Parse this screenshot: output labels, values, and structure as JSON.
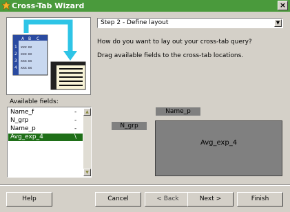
{
  "window": {
    "title": "Cross-Tab Wizard",
    "close_glyph": "×",
    "title_color": "#4a9a3c"
  },
  "step_combo": {
    "value": "Step 2 - Define layout",
    "arrow_glyph": "▼"
  },
  "instructions": {
    "question": "How do you want to lay out your cross-tab query?",
    "hint": "Drag available fields to the cross-tab locations."
  },
  "available_fields": {
    "label": "Available fields:",
    "items": [
      {
        "name": "Name_f",
        "marker": "-"
      },
      {
        "name": "N_grp",
        "marker": "-"
      },
      {
        "name": "Name_p",
        "marker": "-"
      },
      {
        "name": "Avg_exp_4",
        "marker": "\\",
        "selected": true
      }
    ],
    "scroll_up_glyph": "▲",
    "scroll_down_glyph": "▼"
  },
  "layout": {
    "column_field": "Name_p",
    "row_field": "N_grp",
    "data_field": "Avg_exp_4"
  },
  "buttons": {
    "help": "Help",
    "cancel": "Cancel",
    "back": "< Back",
    "next": "Next >",
    "finish": "Finish"
  },
  "illustration": {
    "row_numbers": [
      "1",
      "2",
      "3",
      "4"
    ],
    "header_letters": [
      "A",
      "B",
      "C"
    ],
    "cell_text": "xxx xx"
  },
  "colors": {
    "selection": "#1f6f18",
    "arrow": "#2ec4e6",
    "field_box": "#808080"
  }
}
